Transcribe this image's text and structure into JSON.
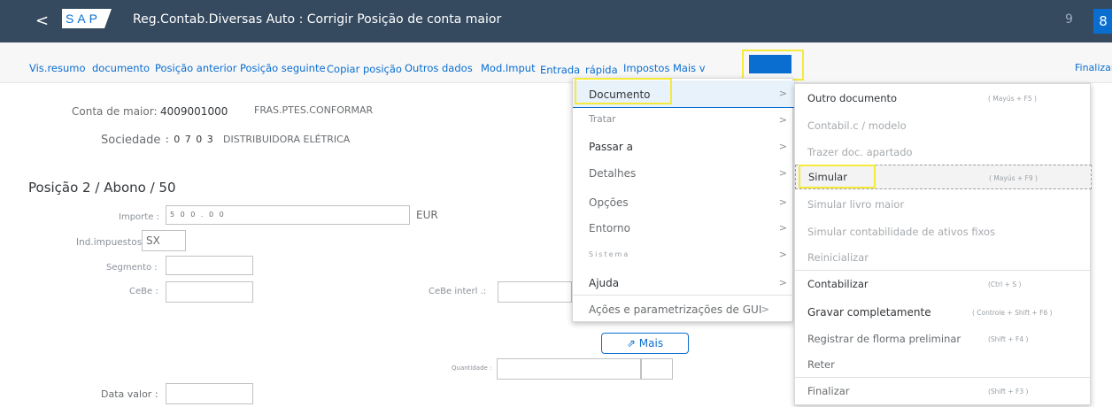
{
  "header": {
    "back": "<",
    "logo": "SAP",
    "title": "Reg.Contab.Diversas Auto : Corrigir Posição de conta maior",
    "num1": "9",
    "num2": "8"
  },
  "toolbar": {
    "items": [
      "Vis.resumo",
      "documento",
      "Posição anterior",
      "Posição seguinte",
      "Copiar posição",
      "Outros dados",
      "Mod.Imput",
      "Entrada",
      "rápida",
      "Impostos",
      "Mais v"
    ],
    "right": "Finalizar"
  },
  "form": {
    "conta_label": "Conta de maior:",
    "conta_value": "4009001000",
    "conta_desc": "FRAS.PTES.CONFORMAR",
    "sociedade_label": "Sociedade",
    "sociedade_value": ": 0 7 0 3",
    "sociedade_desc": "DISTRIBUIDORA ELÉTRICA",
    "section_title": "Posição 2 / Abono / 50",
    "importe_label": "Importe :",
    "importe_value": "5 0 0 . 0 0",
    "currency": "EUR",
    "ind_label": "Ind.impuestos :",
    "ind_value": "SX",
    "segmento_label": "Segmento :",
    "cebe_label": "CeBe :",
    "cebe_interl_label": "CeBe interl .:",
    "mais_label": "Mais",
    "quantidade_label": "Quantidade :",
    "data_valor_label": "Data valor :"
  },
  "menu_main": {
    "items": [
      {
        "label": "Documento",
        "arrow": ">"
      },
      {
        "label": "Tratar",
        "arrow": ">"
      },
      {
        "label": "Passar a",
        "arrow": ">"
      },
      {
        "label": "Detalhes",
        "arrow": ">"
      },
      {
        "label": "Opções",
        "arrow": ">"
      },
      {
        "label": "Entorno",
        "arrow": ">"
      },
      {
        "label": "Sistema",
        "arrow": ">"
      },
      {
        "label": "Ajuda",
        "arrow": ">"
      },
      {
        "label": "Ações e parametrizações de GUI",
        "arrow": ">"
      }
    ]
  },
  "menu_sub": {
    "items": [
      {
        "label": "Outro documento",
        "shortcut": "( Mayús + F5 )"
      },
      {
        "label": "Contabil.c  /  modelo",
        "shortcut": ""
      },
      {
        "label": "Trazer doc. apartado",
        "shortcut": ""
      },
      {
        "label": "Simular",
        "shortcut": "( Mayús + F9 )"
      },
      {
        "label": "Simular livro maior",
        "shortcut": ""
      },
      {
        "label": "Simular contabilidade de ativos fixos",
        "shortcut": ""
      },
      {
        "label": "Reinicializar",
        "shortcut": ""
      },
      {
        "label": "Contabilizar",
        "shortcut": "(Ctrl + S )"
      },
      {
        "label": "Gravar completamente",
        "shortcut": "( Controle + Shift + F6 )"
      },
      {
        "label": "Registrar  de  florma  preliminar",
        "shortcut": "(Shift + F4 )"
      },
      {
        "label": "Reter",
        "shortcut": ""
      },
      {
        "label": "Finalizar",
        "shortcut": "(Shift + F3 )"
      }
    ]
  },
  "colors": {
    "shell": "#354a5f",
    "accent": "#0a6ed1",
    "highlight": "#f5e93a"
  }
}
